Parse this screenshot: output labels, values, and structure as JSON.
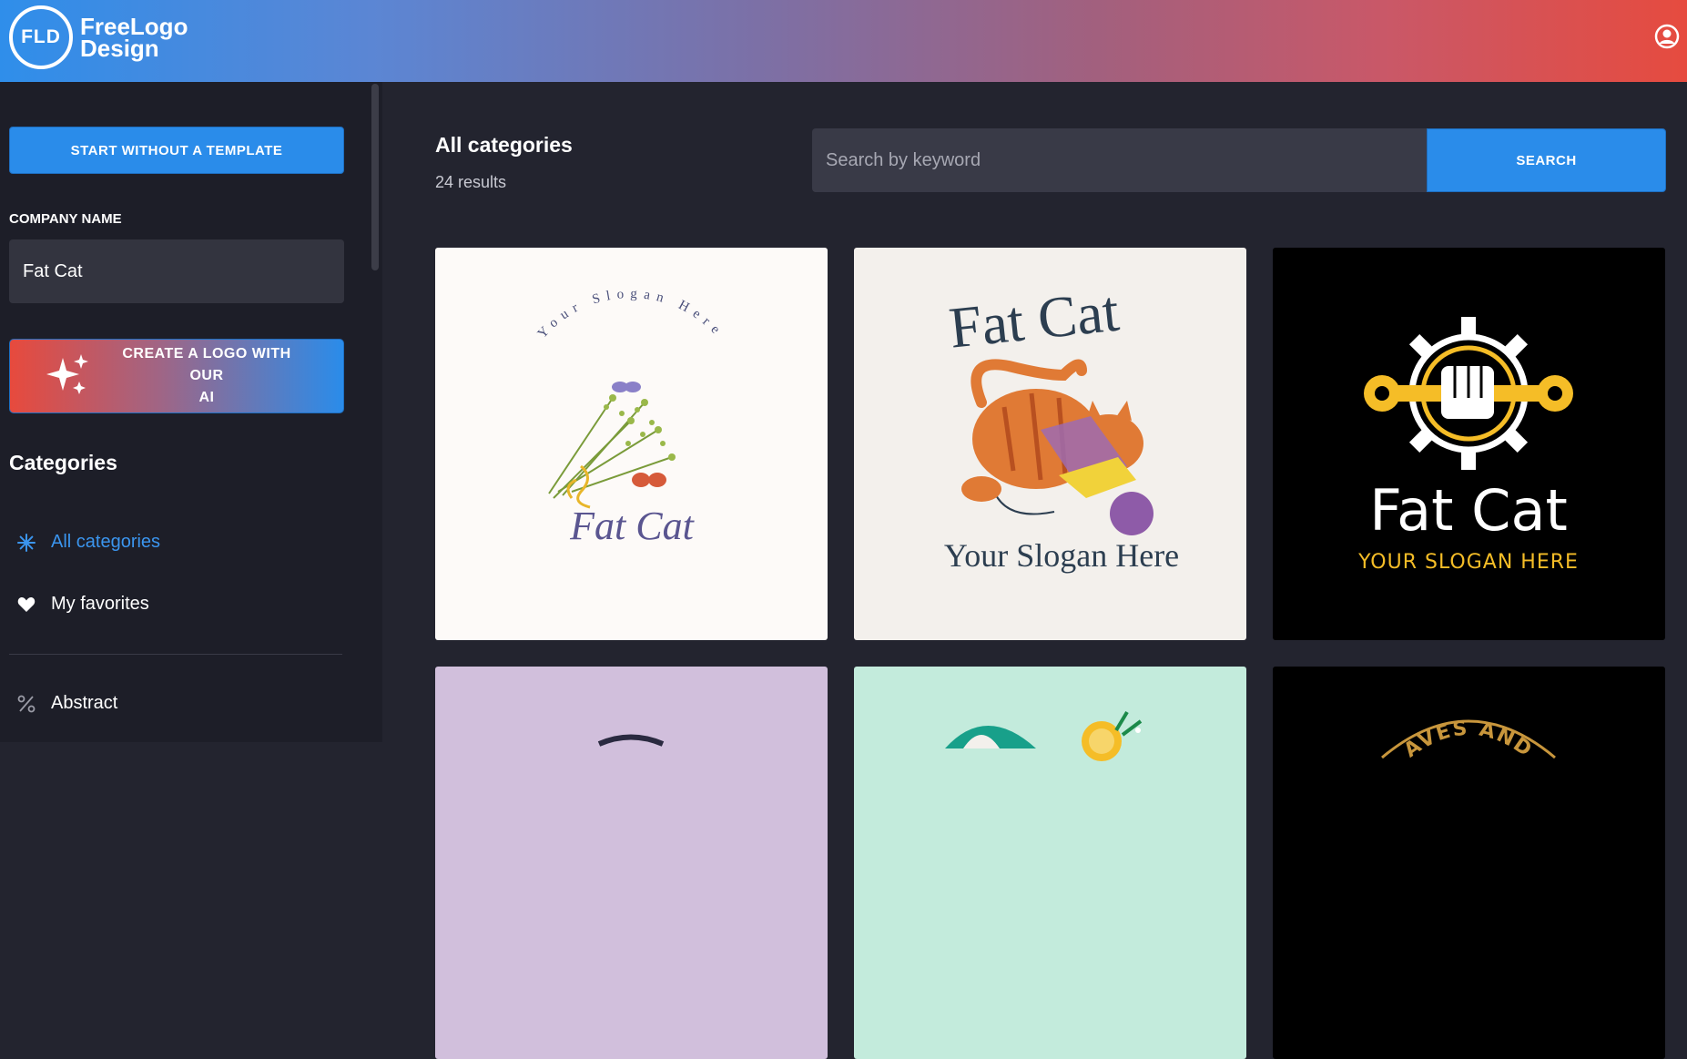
{
  "header": {
    "logo_mark": "FLD",
    "logo_line1": "FreeLogo",
    "logo_line2": "Design",
    "user_icon": "user-circle-icon"
  },
  "sidebar": {
    "start_button": "START WITHOUT A TEMPLATE",
    "company_label": "COMPANY NAME",
    "company_value": "Fat Cat",
    "ai_button_line1": "CREATE A LOGO WITH OUR",
    "ai_button_line2": "AI",
    "categories_heading": "Categories",
    "nav": [
      {
        "label": "All categories",
        "icon": "asterisk-icon",
        "active": true
      },
      {
        "label": "My favorites",
        "icon": "heart-icon",
        "active": false
      },
      {
        "label": "Abstract",
        "icon": "percent-icon",
        "active": false
      }
    ]
  },
  "main": {
    "title": "All categories",
    "results": "24 results",
    "search_placeholder": "Search by keyword",
    "search_button": "SEARCH",
    "cards": [
      {
        "name": "Fat Cat",
        "slogan": "Your Slogan Here",
        "bg": "#fdfaf8"
      },
      {
        "name": "Fat Cat",
        "slogan": "Your Slogan Here",
        "bg": "#f3f0ec"
      },
      {
        "name": "Fat Cat",
        "slogan": "YOUR SLOGAN HERE",
        "bg": "#000000"
      },
      {
        "bg": "#d1bfdc"
      },
      {
        "bg": "#c3ebdc"
      },
      {
        "slogan_partial": "AVES AND",
        "bg": "#000000"
      }
    ]
  },
  "colors": {
    "accent_blue": "#2a8cea",
    "sidebar_bg": "#1d1e28",
    "main_bg": "#23242f",
    "active_nav": "#3b95ee",
    "gold": "#f5bd27"
  }
}
